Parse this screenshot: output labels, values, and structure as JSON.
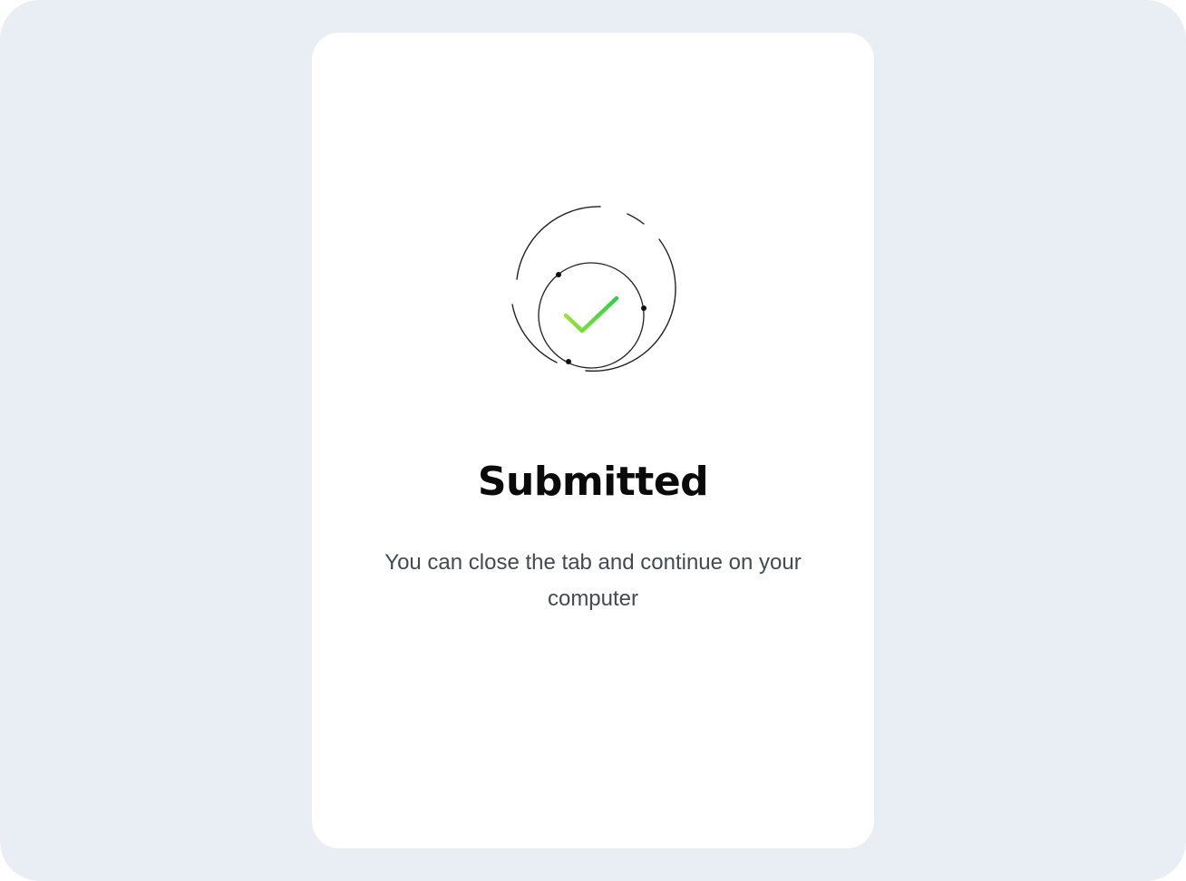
{
  "status": {
    "icon": "check-icon",
    "title": "Submitted",
    "message": "You can close the tab and continue on your computer"
  },
  "colors": {
    "background": "#e9edf4",
    "card": "#ffffff",
    "title": "#0a0a0a",
    "message": "#444a52",
    "check_start": "#9be23a",
    "check_end": "#2fd144",
    "rings": "#222222"
  }
}
